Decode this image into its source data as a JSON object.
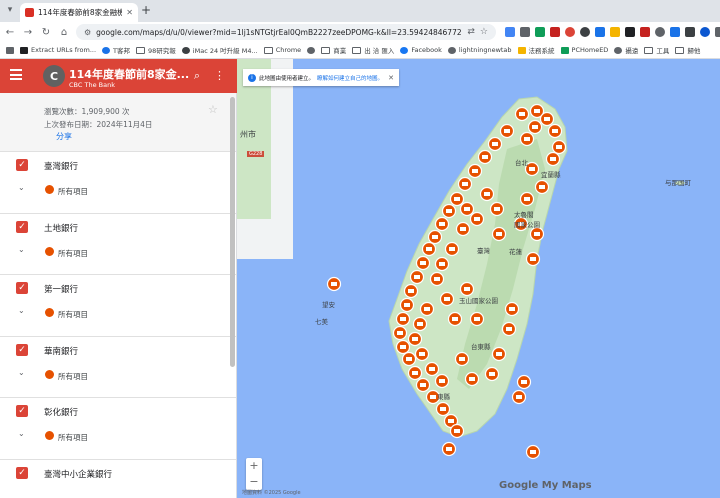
{
  "browser": {
    "tab_title": "114年度春節前8家金融機構之...",
    "url": "google.com/maps/d/u/0/viewer?mid=1lj1sNTGtjrEal0QmB2227zeeDPOMG-k&ll=23.59424846772209%2C12...",
    "bookmarks": [
      "Extract URLs from...",
      "T客邦",
      "98研究報",
      "iMac 24 吋升級 M4...",
      "Chrome",
      "商業",
      "出 洽 匯入",
      "Facebook",
      "lightningnewtab",
      "法務系統",
      "PCHomeED",
      "攝遠",
      "工具",
      "歸他"
    ]
  },
  "app": {
    "title": "114年度春節前8家金...",
    "subtitle": "CBC The Bank",
    "avatar_letter": "C",
    "views_text": "瀏覽次數：1,909,900 次",
    "published_text": "上次發布日期：2024年11月4日",
    "share_label": "分享"
  },
  "layers": [
    {
      "name": "臺灣銀行",
      "sub": "所有項目"
    },
    {
      "name": "土地銀行",
      "sub": "所有項目"
    },
    {
      "name": "第一銀行",
      "sub": "所有項目"
    },
    {
      "name": "華南銀行",
      "sub": "所有項目"
    },
    {
      "name": "彰化銀行",
      "sub": "所有項目"
    },
    {
      "name": "臺灣中小企業銀行",
      "sub": "所有項目"
    }
  ],
  "map": {
    "banner_text": "此地圖由使用者建立。",
    "banner_link": "瞭解如何建立自己的地圖。",
    "brand": "Google My Maps",
    "labels": {
      "fuzhou": "州市",
      "taipei": "台北",
      "yilan": "宜蘭縣",
      "yonaguni": "与那国町",
      "taroko": "太魯閣",
      "hualien_park": "國家公園",
      "hualien": "花蓮",
      "nantou": "臺灣",
      "yushan": "玉山國家公園",
      "taitung": "台東縣",
      "penghu": "望安",
      "qimei": "七美",
      "pingtung": "東縣"
    },
    "road": "G228",
    "copyright": "地圖資料 ©2025 Google"
  },
  "colors": {
    "accent": "#db4437",
    "marker": "#e65100",
    "water": "#8ab4f8",
    "land": "#cde6c5"
  }
}
